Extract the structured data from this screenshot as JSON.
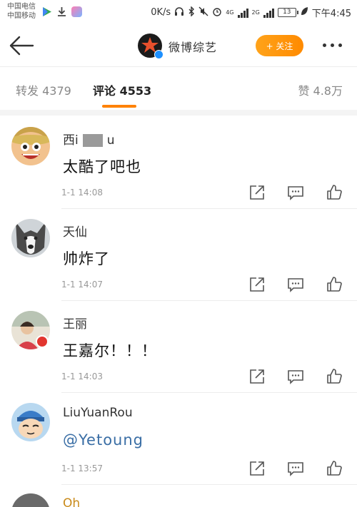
{
  "status_bar": {
    "carrier_1": "中国电信",
    "carrier_2": "中国移动",
    "net_speed": "0K/s",
    "net_1": "4G",
    "net_2": "2G",
    "battery": "13",
    "time": "下午4:45"
  },
  "nav": {
    "title": "微博综艺",
    "follow_label": "+ 关注"
  },
  "tabs": {
    "repost": "转发 4379",
    "comments": "评论 4553",
    "likes": "赞 4.8万"
  },
  "comments": [
    {
      "name": "西i",
      "name_tail": "u",
      "text": "太酷了吧也",
      "time": "1-1 14:08"
    },
    {
      "name": "天仙",
      "name_tail": "",
      "text": "帅炸了",
      "time": "1-1 14:07"
    },
    {
      "name": "王丽",
      "name_tail": "",
      "text": "王嘉尔！！！",
      "time": "1-1 14:03"
    },
    {
      "name": "LiuYuanRou",
      "name_tail": "",
      "text": "@Yetoung",
      "time": "1-1 13:57"
    },
    {
      "name": "Oh",
      "name_tail": "",
      "text": "",
      "time": ""
    }
  ],
  "colors": {
    "accent": "#ff8200",
    "mention": "#3a6ea5"
  }
}
